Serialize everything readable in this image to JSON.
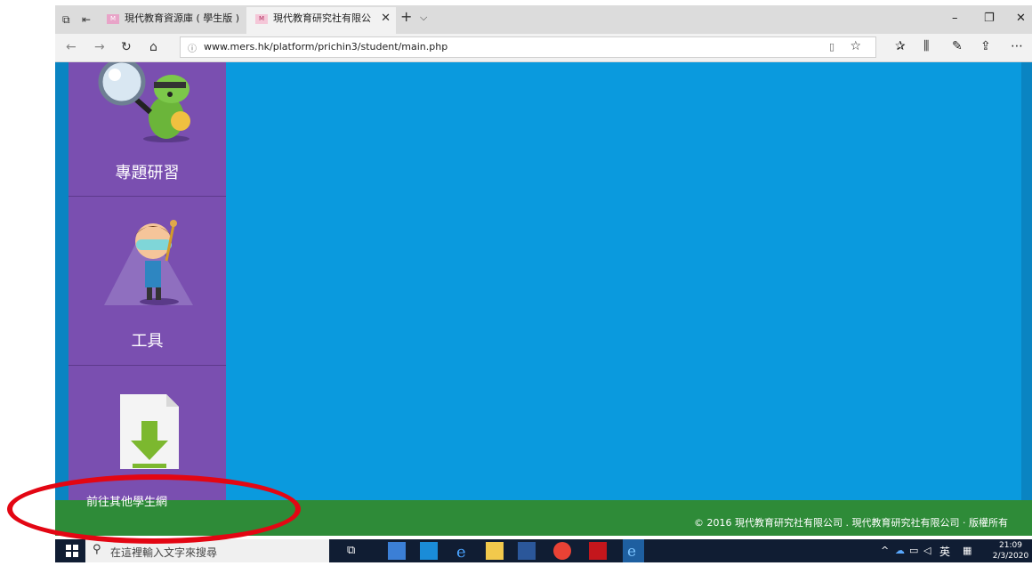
{
  "browser": {
    "tabs": [
      {
        "title": "現代教育資源庫 ( 學生版 )"
      },
      {
        "title": "現代教育研究社有限公"
      }
    ],
    "url": "www.mers.hk/platform/prichin3/student/main.php"
  },
  "page": {
    "sidebar": [
      {
        "label": "專題研習",
        "icon": "magnifier-turtle-icon"
      },
      {
        "label": "工具",
        "icon": "boy-with-goggles-icon"
      },
      {
        "label": "",
        "icon": "download-document-icon"
      }
    ],
    "footer_link": "前往其他學生網",
    "copyright": "© 2016 現代教育研究社有限公司 . 現代教育研究社有限公司 · 版權所有",
    "colors": {
      "content": "#0a9ade",
      "sidebar": "#7a4fb0",
      "footer": "#2e8b38"
    }
  },
  "taskbar": {
    "search_placeholder": "在這裡輸入文字來搜尋",
    "ime": "英",
    "time": "21:09",
    "date": "2/3/2020"
  },
  "annotation": {
    "color": "#e30613"
  }
}
